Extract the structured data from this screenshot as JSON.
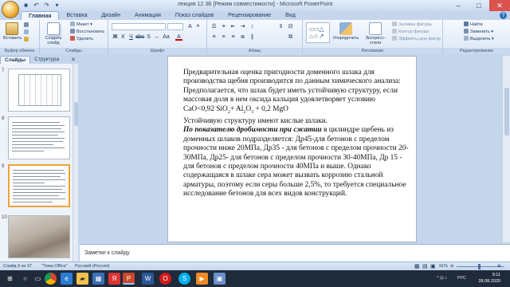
{
  "window": {
    "title": "лекция 12 3Б [Режим совместимости] - Microsoft PowerPoint"
  },
  "ribbon": {
    "tabs": [
      "Главная",
      "Вставка",
      "Дизайн",
      "Анимация",
      "Показ слайдов",
      "Рецензирование",
      "Вид"
    ],
    "groups": {
      "clipboard": {
        "label": "Буфер обмена",
        "paste": "Вставить",
        "cut": "",
        "copy": "",
        "format": ""
      },
      "slides": {
        "label": "Слайды",
        "create": "Создать слайд",
        "layout": "Макет",
        "reset": "Восстановить",
        "delete": "Удалить"
      },
      "font": {
        "label": "Шрифт"
      },
      "paragraph": {
        "label": "Абзац"
      },
      "drawing": {
        "label": "Рисование",
        "arrange": "Упорядочить",
        "quick_styles": "Экспресс-стили",
        "fill": "Заливка фигуры",
        "outline": "Контур фигуры",
        "effects": "Эффекты для фигур"
      },
      "editing": {
        "label": "Редактирование",
        "find": "Найти",
        "replace": "Заменить",
        "select": "Выделить"
      }
    }
  },
  "pane": {
    "tabs": [
      "Слайды",
      "Структура"
    ],
    "thumb_numbers": [
      "7",
      "8",
      "9",
      "10"
    ]
  },
  "slide": {
    "paragraph1": "Предварительная оценка пригодности доменного шлака для производства щебня производится по данным химического анализа: Предполагается, что шлак будет иметь устойчивую структуру, если массовая доля в нем оксида кальция удовлетворяет условию",
    "formula_a": "CaO<0,92 SiO",
    "formula_sub1": "2",
    "formula_b": "+ Al",
    "formula_sub2": "2",
    "formula_c": "O",
    "formula_sub3": "3",
    "formula_d": " + 0,2 MgO",
    "paragraph2": "Устойчивую структуру имеют кислые шлаки.",
    "bold_lead": "По показателю дробимости при сжатии",
    "paragraph3": " в цилиндре щебень из доменных шлаков подразделяется: Др45-для бетонов с пределом прочности ниже 20МПа, Др35 - для бетонов с пределом прочности 20-30МПа, Др25- для бетонов с пределом прочности 30-40МПа, Др 15 - для бетонов с пределом прочности  40МПа и выше. Однако содержащаяся в шлаке сера может вызвать коррозию стальной арматуры, поэтому если серы больше 2,5%, то требуется специальное исследование бетонов для всех видов конструкций."
  },
  "notes": {
    "placeholder": "Заметки к слайду"
  },
  "status": {
    "slide_of": "Слайд 9 из 37",
    "theme": "\"Тема Office\"",
    "language": "Русский (Россия)",
    "zoom": "91%"
  },
  "taskbar": {
    "clock_time": "9:11",
    "clock_date": "28.08.2020",
    "lang": "РУС"
  }
}
